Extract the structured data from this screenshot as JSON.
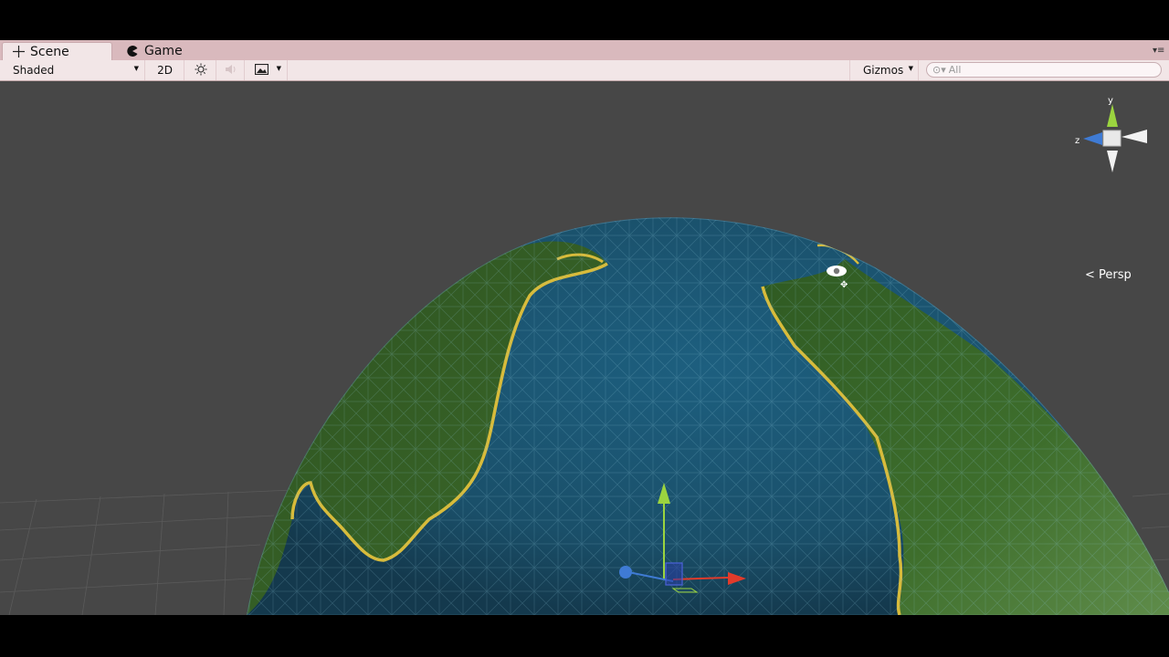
{
  "tabs": [
    {
      "label": "Scene",
      "icon": "scene-crosshair-icon",
      "active": true
    },
    {
      "label": "Game",
      "icon": "game-pacman-icon",
      "active": false
    }
  ],
  "toolbar": {
    "shading_mode": "Shaded",
    "mode_2d_label": "2D",
    "lighting_icon": "sun-icon",
    "audio_icon": "speaker-icon",
    "effects_icon": "image-icon",
    "gizmos_label": "Gizmos",
    "search_prefix": "⊙▾",
    "search_placeholder": "All"
  },
  "scene_gizmo": {
    "projection_label": "Persp",
    "axes": {
      "y": "y",
      "z": "z"
    },
    "colors": {
      "y": "#9bd43f",
      "z": "#3f7bd4",
      "x": "#e23b2b"
    }
  },
  "colors": {
    "ocean": "#1f5a76",
    "land": "#3c6a2a",
    "coast": "#d8bb3a",
    "background": "#474747",
    "tabbar": "#d9b9bd"
  }
}
